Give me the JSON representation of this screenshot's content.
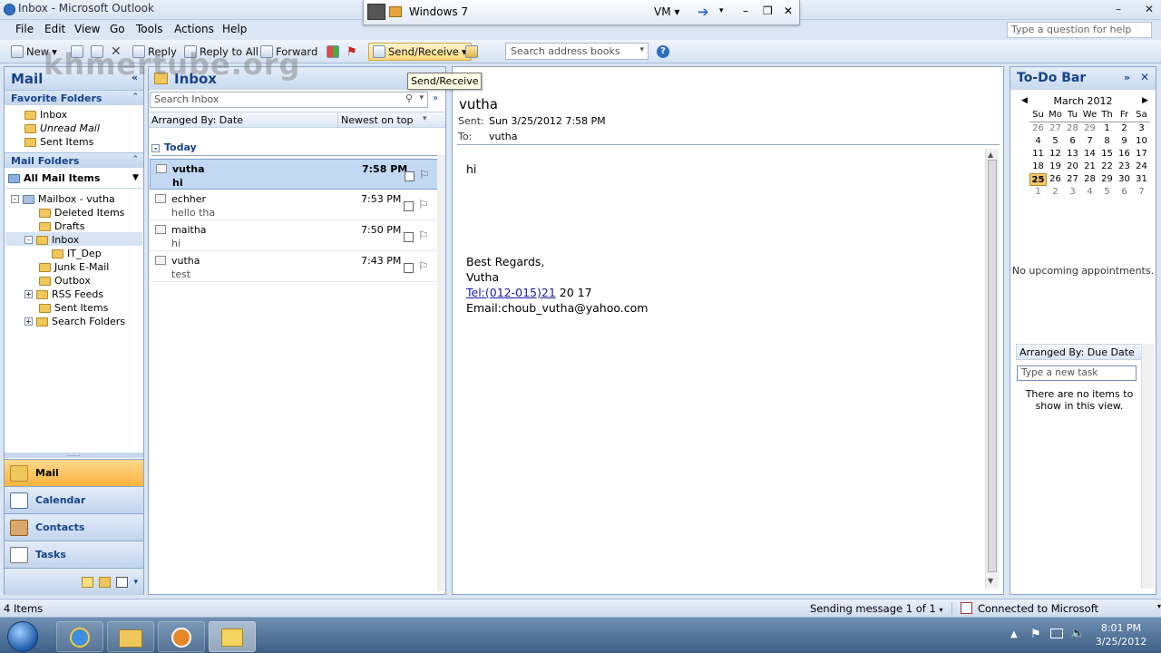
{
  "window": {
    "title": "Inbox - Microsoft Outlook"
  },
  "vm_bar": {
    "label": "Windows 7",
    "menu": "VM"
  },
  "menu": [
    "File",
    "Edit",
    "View",
    "Go",
    "Tools",
    "Actions",
    "Help"
  ],
  "help_placeholder": "Type a question for help",
  "toolbar": {
    "new": "New",
    "reply": "Reply",
    "reply_all": "Reply to All",
    "forward": "Forward",
    "send_receive": "Send/Receive",
    "search_books": "Search address books",
    "tooltip": "Send/Receive"
  },
  "watermark": "khmertube.org",
  "nav": {
    "title": "Mail",
    "favorites_title": "Favorite Folders",
    "favorites": [
      "Inbox",
      "Unread Mail",
      "Sent Items"
    ],
    "mail_folders_title": "Mail Folders",
    "all_mail": "All Mail Items",
    "mailbox": "Mailbox - vutha",
    "folders": [
      "Deleted Items",
      "Drafts",
      "Inbox",
      "IT_Dep",
      "Junk E-Mail",
      "Outbox",
      "RSS Feeds",
      "Sent Items",
      "Search Folders"
    ],
    "buttons": [
      "Mail",
      "Calendar",
      "Contacts",
      "Tasks"
    ]
  },
  "list": {
    "title": "Inbox",
    "search_placeholder": "Search Inbox",
    "arranged_by": "Arranged By: Date",
    "sort_order": "Newest on top",
    "group": "Today",
    "messages": [
      {
        "from": "vutha",
        "subject": "hi",
        "time": "7:58 PM"
      },
      {
        "from": "echher",
        "subject": "hello tha",
        "time": "7:53 PM"
      },
      {
        "from": "maitha",
        "subject": "hi",
        "time": "7:50 PM"
      },
      {
        "from": "vutha",
        "subject": "test",
        "time": "7:43 PM"
      }
    ]
  },
  "reading": {
    "from": "vutha",
    "sent_label": "Sent:",
    "sent": "Sun 3/25/2012 7:58 PM",
    "to_label": "To:",
    "to": "vutha",
    "greeting": "hi",
    "regards": "Best Regards,",
    "name": "Vutha",
    "tel_link": "Tel:(012-015)21",
    "tel_rest": " 20 17",
    "email": "Email:choub_vutha@yahoo.com"
  },
  "todo": {
    "title": "To-Do Bar",
    "month": "March 2012",
    "weekdays": [
      "Su",
      "Mo",
      "Tu",
      "We",
      "Th",
      "Fr",
      "Sa"
    ],
    "weeks": [
      [
        "26",
        "27",
        "28",
        "29",
        "1",
        "2",
        "3"
      ],
      [
        "4",
        "5",
        "6",
        "7",
        "8",
        "9",
        "10"
      ],
      [
        "11",
        "12",
        "13",
        "14",
        "15",
        "16",
        "17"
      ],
      [
        "18",
        "19",
        "20",
        "21",
        "22",
        "23",
        "24"
      ],
      [
        "25",
        "26",
        "27",
        "28",
        "29",
        "30",
        "31"
      ],
      [
        "1",
        "2",
        "3",
        "4",
        "5",
        "6",
        "7"
      ]
    ],
    "today": "25",
    "no_appointments": "No upcoming appointments.",
    "arranged_by": "Arranged By: Due Date",
    "task_placeholder": "Type a new task",
    "empty": "There are no items to show in this view."
  },
  "status": {
    "items": "4 Items",
    "sending": "Sending message 1 of 1",
    "connection": "Connected to Microsoft Exchange"
  },
  "clock": {
    "time": "8:01 PM",
    "date": "3/25/2012"
  }
}
